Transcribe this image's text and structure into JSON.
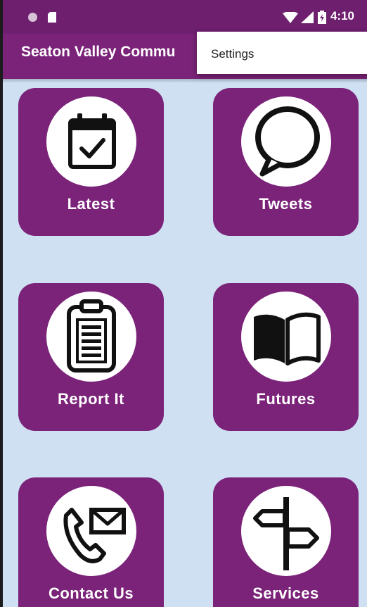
{
  "status_bar": {
    "time": "4:10"
  },
  "app_bar": {
    "title": "Seaton Valley Commu"
  },
  "overflow_menu": {
    "items": [
      {
        "label": "Settings"
      }
    ]
  },
  "tiles": [
    {
      "label": "Latest",
      "icon": "calendar-check-icon"
    },
    {
      "label": "Tweets",
      "icon": "speech-bubble-icon"
    },
    {
      "label": "Report It",
      "icon": "clipboard-icon"
    },
    {
      "label": "Futures",
      "icon": "open-book-icon"
    },
    {
      "label": "Contact Us",
      "icon": "phone-envelope-icon"
    },
    {
      "label": "Services",
      "icon": "signpost-icon"
    }
  ],
  "colors": {
    "primary": "#7b2279",
    "status_bar": "#6e1f6e",
    "background": "#cfe0f3",
    "tile_text": "#ffffff"
  }
}
